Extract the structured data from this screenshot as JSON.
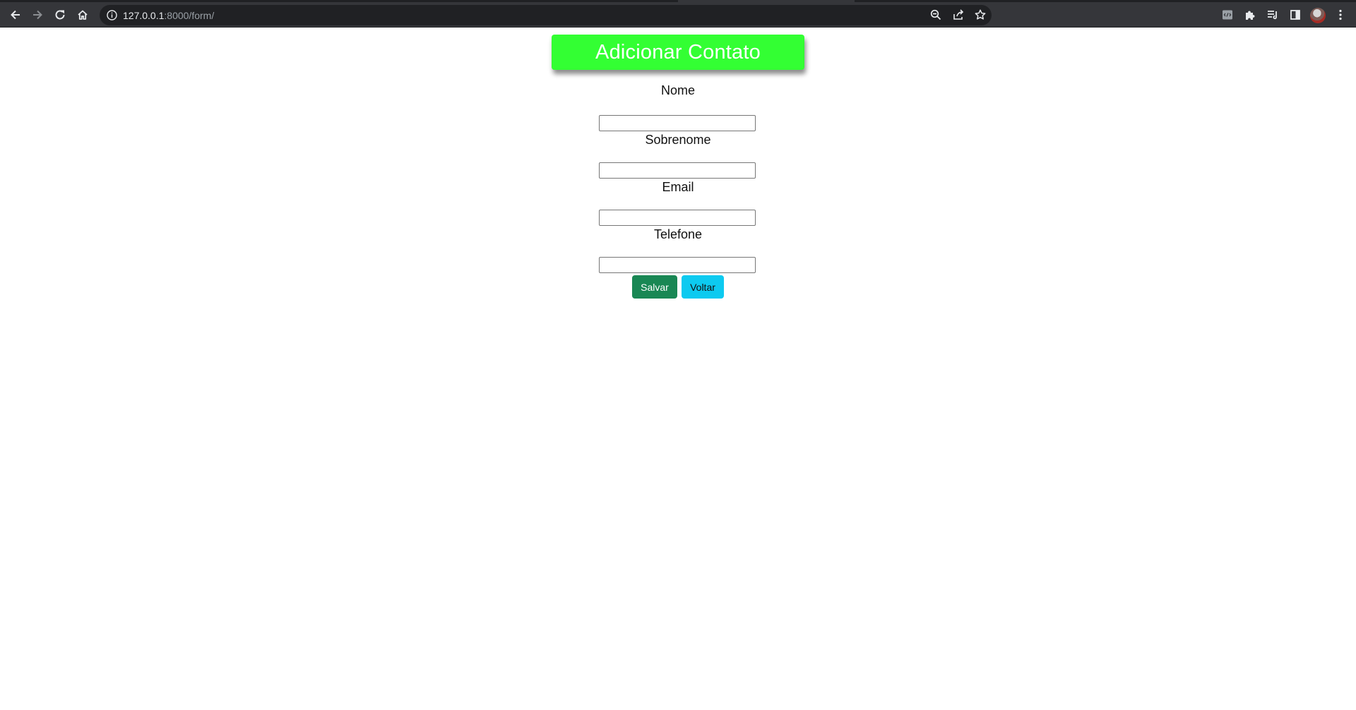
{
  "browser": {
    "url_host": "127.0.0.1",
    "url_rest": ":8000/form/",
    "icons": [
      "back-icon",
      "forward-icon",
      "reload-icon",
      "home-icon",
      "info-icon",
      "zoom-icon",
      "share-icon",
      "bookmark-star-icon",
      "extension-devtools-icon",
      "extensions-puzzle-icon",
      "reading-list-icon",
      "side-panel-icon",
      "profile-avatar",
      "more-menu-icon"
    ]
  },
  "page": {
    "title": "Adicionar Contato",
    "fields": [
      {
        "label": "Nome",
        "value": ""
      },
      {
        "label": "Sobrenome",
        "value": ""
      },
      {
        "label": "Email",
        "value": ""
      },
      {
        "label": "Telefone",
        "value": ""
      }
    ],
    "buttons": {
      "save": "Salvar",
      "back": "Voltar"
    },
    "colors": {
      "title_bg": "#33ff33",
      "save_bg": "#198754",
      "back_bg": "#0dcaf0"
    }
  }
}
